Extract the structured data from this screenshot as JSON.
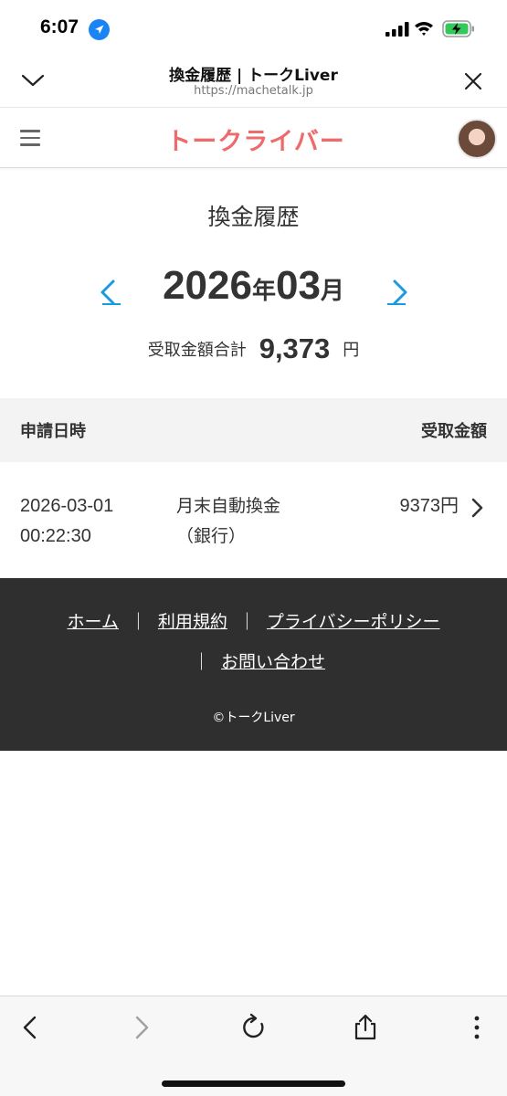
{
  "status_bar": {
    "time": "6:07"
  },
  "browser": {
    "page_title": "換金履歴 | トークLiver",
    "url": "https://machetalk.jp"
  },
  "site": {
    "logo_text": "トークライバー",
    "brand_color": "#ee6b6b",
    "accent_color": "#1a9be0"
  },
  "main": {
    "title": "換金履歴",
    "month": {
      "year": "2026",
      "year_unit": "年",
      "month": "03",
      "month_unit": "月"
    },
    "total": {
      "label": "受取金額合計",
      "amount": "9,373",
      "unit": "円"
    }
  },
  "table": {
    "headers": {
      "date": "申請日時",
      "amount": "受取金額"
    },
    "rows": [
      {
        "date": "2026-03-01",
        "time": "00:22:30",
        "type_line1": "月末自動換金",
        "type_line2": "（銀行）",
        "amount": "9373円"
      }
    ]
  },
  "footer": {
    "links": [
      "ホーム",
      "利用規約",
      "プライバシーポリシー",
      "お問い合わせ"
    ],
    "separator": "｜",
    "copyright": "©トークLiver"
  },
  "icons": {
    "status": [
      "location-arrow-icon",
      "signal-icon",
      "wifi-icon",
      "battery-charging-icon"
    ],
    "browser": [
      "chevron-down-icon",
      "close-icon"
    ],
    "header": [
      "hamburger-menu-icon",
      "avatar"
    ],
    "month_nav": [
      "prev-month-icon",
      "next-month-icon"
    ],
    "toolbar": [
      "back-icon",
      "forward-icon",
      "reload-icon",
      "share-icon",
      "more-icon"
    ]
  }
}
